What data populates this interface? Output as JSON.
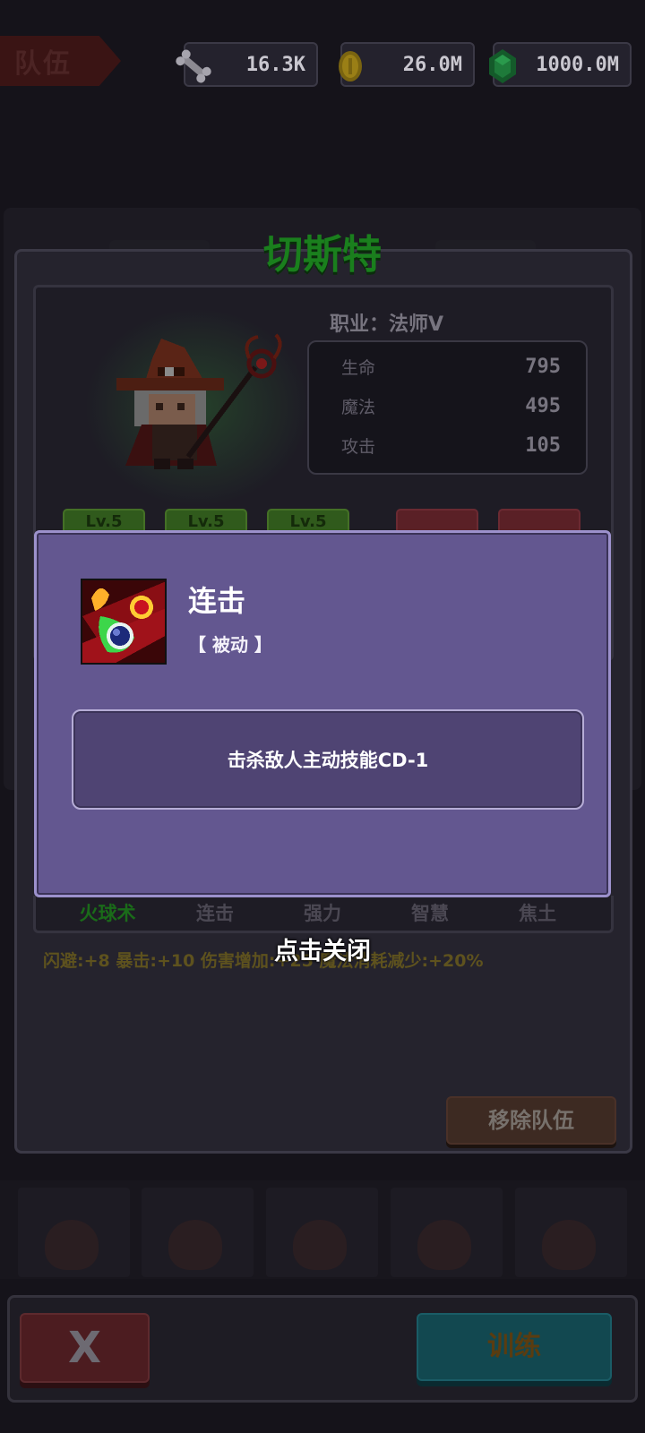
{
  "top_bar": {
    "team_tab_label": "队伍",
    "resources": [
      {
        "icon": "bone-icon",
        "value": "16.3K"
      },
      {
        "icon": "gold-coin-icon",
        "value": "26.0M"
      },
      {
        "icon": "green-gem-icon",
        "value": "1000.0M"
      }
    ]
  },
  "hero": {
    "name": "切斯特",
    "class_line": "职业：法师Ⅴ",
    "portrait_icon": "wizard-hero-icon",
    "stats": [
      {
        "label": "生命",
        "value": "795"
      },
      {
        "label": "魔法",
        "value": "495"
      },
      {
        "label": "攻击",
        "value": "105"
      }
    ],
    "equipment_levels": [
      "Lv.5",
      "Lv.5",
      "Lv.5"
    ]
  },
  "skills": {
    "tabs": [
      "火球术",
      "连击",
      "强力",
      "智慧",
      "焦土"
    ],
    "active_tab": "火球术",
    "bonus_text": "闪避:+8  暴击:+10  伤害增加:+25  魔法消耗减少:+20%"
  },
  "actions": {
    "remove_label": "移除队伍",
    "close_label": "X",
    "train_label": "训练"
  },
  "popup": {
    "skill_icon": "combo-skill-icon",
    "skill_name": "连击",
    "skill_type": "【 被动 】",
    "description": "击杀敌人主动技能CD-1",
    "close_hint": "点击关闭"
  },
  "colors": {
    "hero_name": "#1a7f1d",
    "popup_bg": "#635790",
    "popup_border": "#9c91cc",
    "active_tab": "#1a6b19"
  }
}
